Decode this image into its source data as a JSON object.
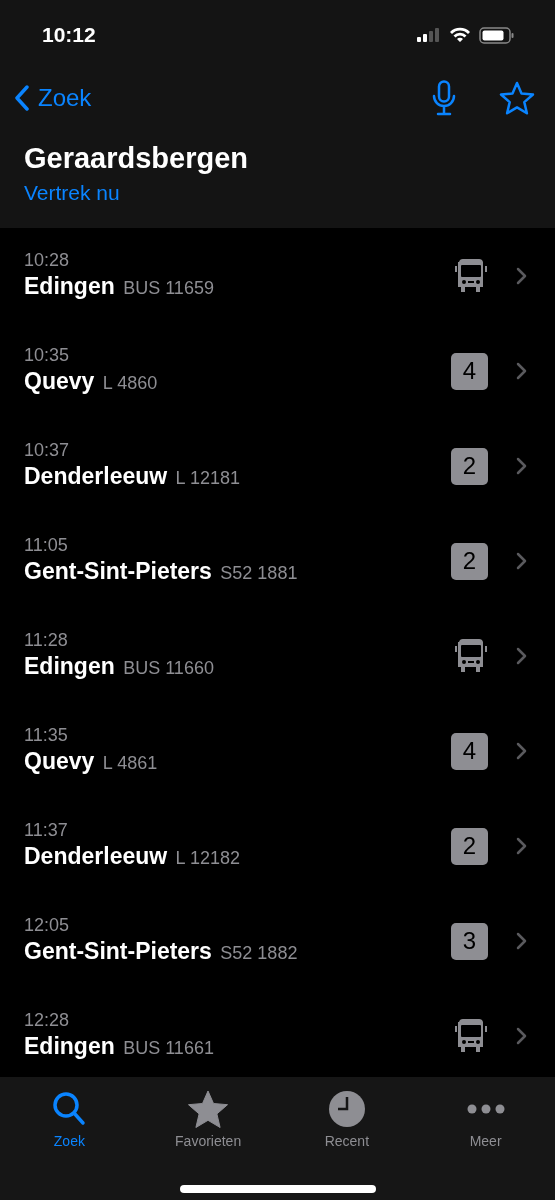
{
  "status_bar": {
    "time": "10:12"
  },
  "nav": {
    "back": "Zoek"
  },
  "header": {
    "title": "Geraardsbergen",
    "subtitle": "Vertrek nu"
  },
  "departures": [
    {
      "time": "10:28",
      "destination": "Edingen",
      "train": "BUS 11659",
      "kind": "bus"
    },
    {
      "time": "10:35",
      "destination": "Quevy",
      "train": "L 4860",
      "kind": "platform",
      "platform": "4"
    },
    {
      "time": "10:37",
      "destination": "Denderleeuw",
      "train": "L 12181",
      "kind": "platform",
      "platform": "2"
    },
    {
      "time": "11:05",
      "destination": "Gent-Sint-Pieters",
      "train": "S52 1881",
      "kind": "platform",
      "platform": "2"
    },
    {
      "time": "11:28",
      "destination": "Edingen",
      "train": "BUS 11660",
      "kind": "bus"
    },
    {
      "time": "11:35",
      "destination": "Quevy",
      "train": "L 4861",
      "kind": "platform",
      "platform": "4"
    },
    {
      "time": "11:37",
      "destination": "Denderleeuw",
      "train": "L 12182",
      "kind": "platform",
      "platform": "2"
    },
    {
      "time": "12:05",
      "destination": "Gent-Sint-Pieters",
      "train": "S52 1882",
      "kind": "platform",
      "platform": "3"
    },
    {
      "time": "12:28",
      "destination": "Edingen",
      "train": "BUS 11661",
      "kind": "bus"
    }
  ],
  "tabs": [
    {
      "label": "Zoek",
      "kind": "search",
      "selected": true
    },
    {
      "label": "Favorieten",
      "kind": "favorites",
      "selected": false
    },
    {
      "label": "Recent",
      "kind": "recent",
      "selected": false
    },
    {
      "label": "Meer",
      "kind": "more",
      "selected": false
    }
  ]
}
